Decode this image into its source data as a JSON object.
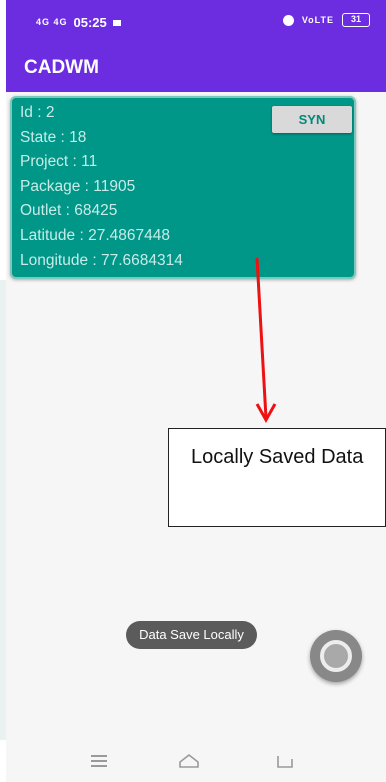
{
  "status_bar": {
    "signal_text": "4G 4G",
    "time": "05:25",
    "right_network": "VoLTE",
    "battery": "31"
  },
  "app_bar": {
    "title": "CADWM"
  },
  "record_card": {
    "lines": [
      "Id : 2",
      "State : 18",
      "Project : 11",
      "Package : 11905",
      "Outlet : 68425",
      "Latitude : 27.4867448",
      "Longitude : 77.6684314"
    ],
    "sync_button_label": "SYN"
  },
  "annotation": {
    "text": "Locally Saved Data",
    "arrow_color": "#ee1111"
  },
  "toast": {
    "message": "Data Save Locally"
  },
  "nav_bar": {
    "icons": [
      "menu-icon",
      "home-icon",
      "back-icon"
    ]
  },
  "colors": {
    "app_bar": "#6c2de0",
    "card": "#009688",
    "card_text": "#c7ece7",
    "sync_button_text": "#00897b"
  }
}
